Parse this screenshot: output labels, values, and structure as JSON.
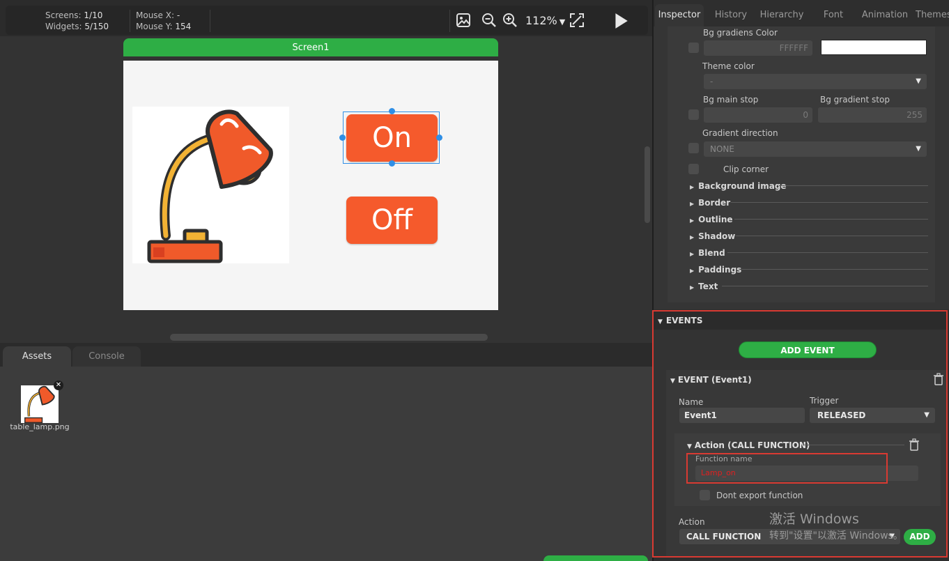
{
  "topbar": {
    "screens_label": "Screens:",
    "screens_value": "1/10",
    "widgets_label": "Widgets:",
    "widgets_value": "5/150",
    "mouse_x_label": "Mouse X:",
    "mouse_x_value": "-",
    "mouse_y_label": "Mouse Y:",
    "mouse_y_value": "154",
    "zoom": "112%"
  },
  "canvas": {
    "screen_name": "Screen1",
    "on_button_label": "On",
    "off_button_label": "Off"
  },
  "bottom_tabs": [
    "Assets",
    "Console"
  ],
  "assets": [
    {
      "name": "table_lamp.png"
    }
  ],
  "inspector": {
    "tabs": [
      "Inspector",
      "History",
      "Hierarchy",
      "Font",
      "Animation",
      "Themes"
    ],
    "active_tab": "Inspector",
    "bg_gradient_color_label": "Bg gradiens Color",
    "bg_gradient_color_value": "FFFFFF",
    "theme_color_label": "Theme color",
    "theme_color_value": "-",
    "bg_main_stop_label": "Bg main stop",
    "bg_main_stop_value": "0",
    "bg_gradient_stop_label": "Bg gradient stop",
    "bg_gradient_stop_value": "255",
    "gradient_direction_label": "Gradient direction",
    "gradient_direction_value": "NONE",
    "clip_corner_label": "Clip corner",
    "sections": [
      "Background image",
      "Border",
      "Outline",
      "Shadow",
      "Blend",
      "Paddings",
      "Text"
    ]
  },
  "events": {
    "header": "EVENTS",
    "add_event_label": "ADD EVENT",
    "event_title": "EVENT (Event1)",
    "name_label": "Name",
    "name_value": "Event1",
    "trigger_label": "Trigger",
    "trigger_value": "RELEASED",
    "action_title": "Action (CALL FUNCTION)",
    "function_name_label": "Function name",
    "function_name_value": "Lamp_on",
    "dont_export_label": "Dont export function",
    "action_label": "Action",
    "action_value": "CALL FUNCTION",
    "add_label": "ADD"
  },
  "watermark": {
    "line1": "激活 Windows",
    "line2": "转到\"设置\"以激活 Windows。"
  },
  "colors": {
    "accent_green": "#2eae45",
    "button_orange": "#f55a2c",
    "selection_blue": "#2f8fe6",
    "highlight_red": "#d93a32"
  }
}
